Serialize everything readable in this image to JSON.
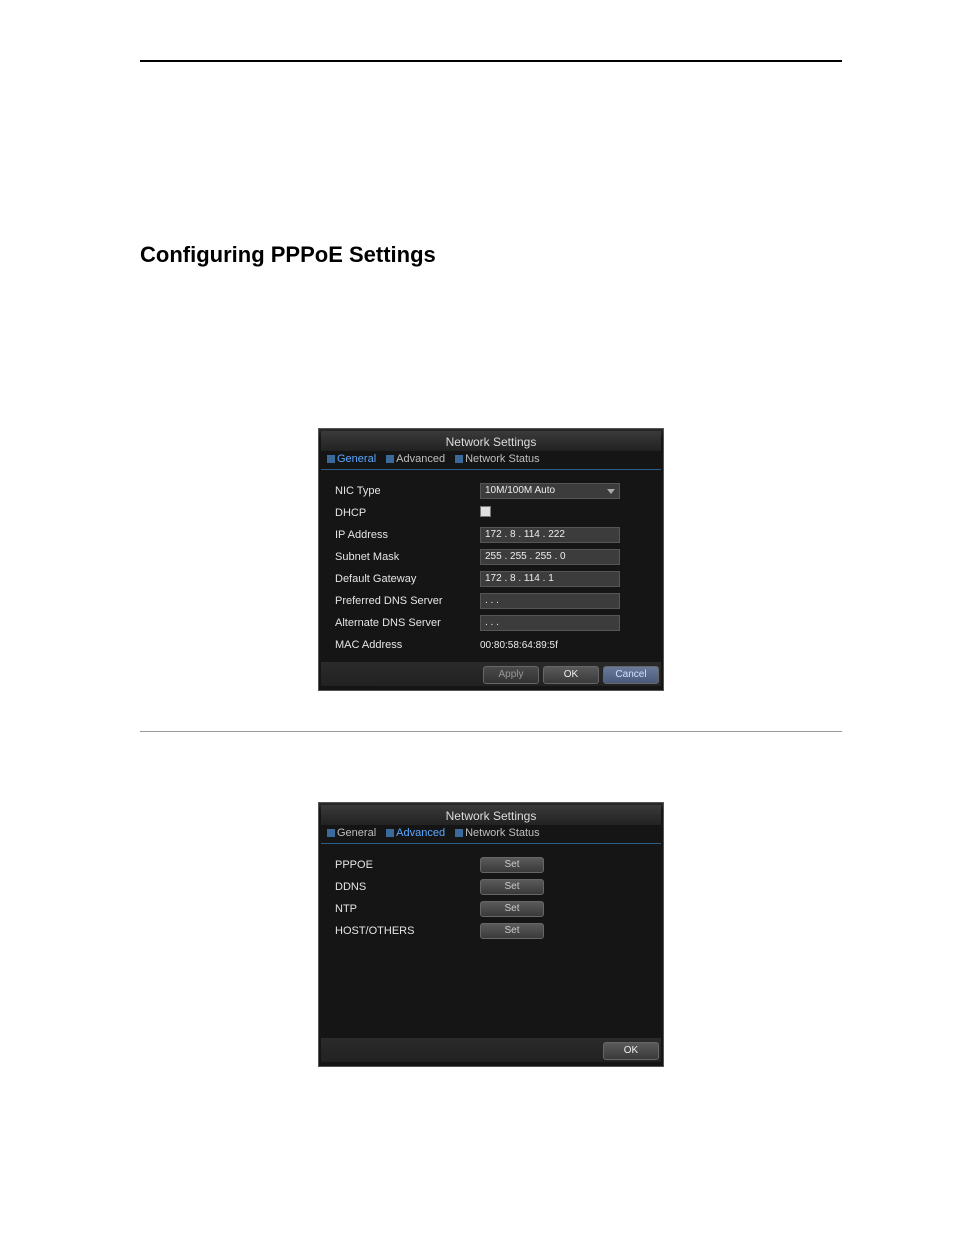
{
  "section_title": "Configuring PPPoE Settings",
  "dialog1": {
    "title": "Network Settings",
    "tabs": [
      "General",
      "Advanced",
      "Network Status"
    ],
    "active_tab_index": 0,
    "fields": {
      "nic_type": {
        "label": "NIC Type",
        "value": "10M/100M Auto"
      },
      "dhcp": {
        "label": "DHCP"
      },
      "ip_address": {
        "label": "IP Address",
        "value": "172 . 8    . 114 . 222"
      },
      "subnet_mask": {
        "label": "Subnet Mask",
        "value": "255 . 255 . 255 . 0"
      },
      "default_gateway": {
        "label": "Default Gateway",
        "value": "172 . 8    . 114 . 1"
      },
      "preferred_dns": {
        "label": "Preferred DNS Server",
        "value": "  .     .     .   "
      },
      "alternate_dns": {
        "label": "Alternate DNS Server",
        "value": "  .     .     .   "
      },
      "mac_address": {
        "label": "MAC Address",
        "value": "00:80:58:64:89:5f"
      }
    },
    "buttons": {
      "apply": "Apply",
      "ok": "OK",
      "cancel": "Cancel"
    }
  },
  "dialog2": {
    "title": "Network Settings",
    "tabs": [
      "General",
      "Advanced",
      "Network Status"
    ],
    "active_tab_index": 1,
    "rows": [
      {
        "label": "PPPOE",
        "button": "Set"
      },
      {
        "label": "DDNS",
        "button": "Set"
      },
      {
        "label": "NTP",
        "button": "Set"
      },
      {
        "label": "HOST/OTHERS",
        "button": "Set"
      }
    ],
    "buttons": {
      "ok": "OK"
    }
  }
}
